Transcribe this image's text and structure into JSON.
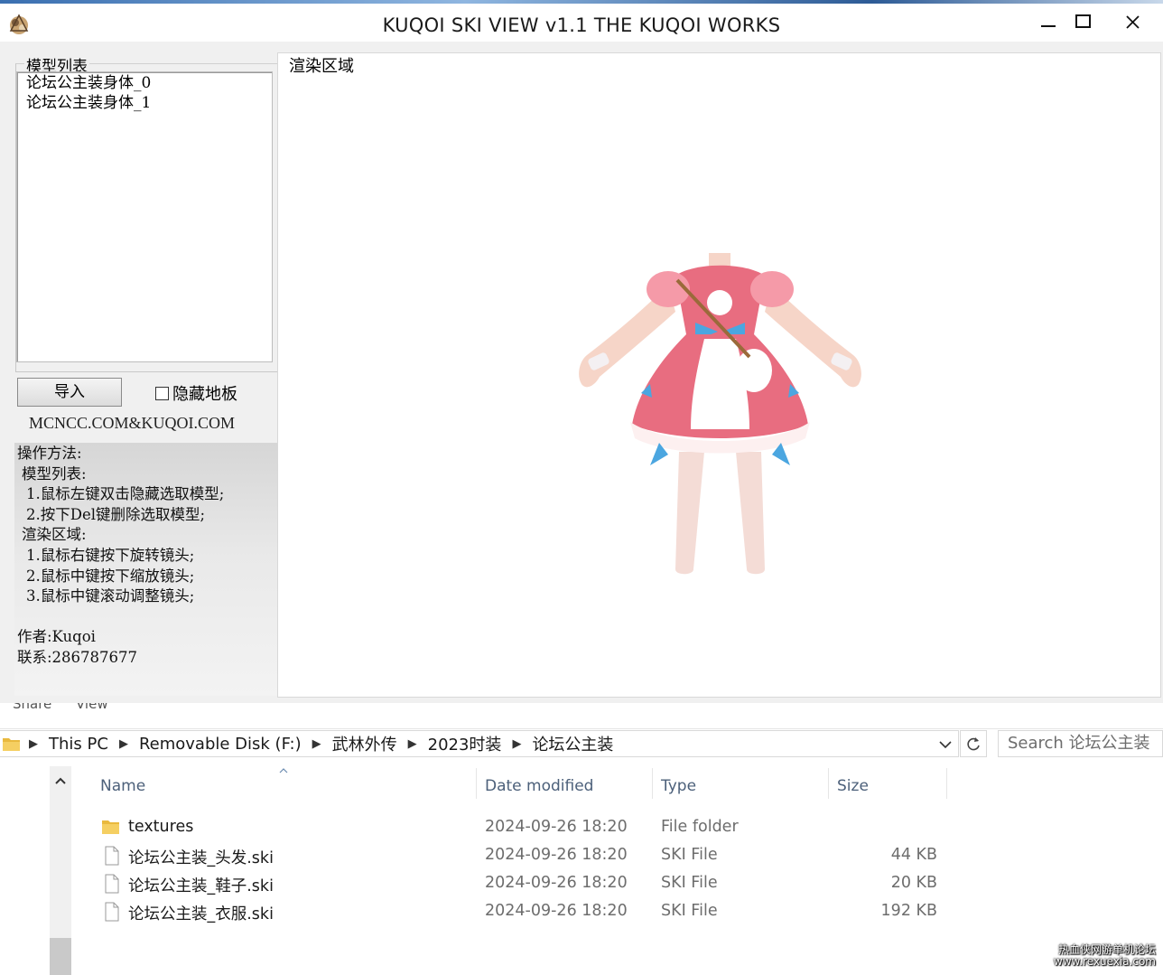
{
  "app": {
    "title": "KUQOI SKI VIEW v1.1 THE KUQOI WORKS",
    "model_list_label": "模型列表",
    "models": [
      "论坛公主装身体_0",
      "论坛公主装身体_1"
    ],
    "import_label": "导入",
    "hide_floor_label": "隐藏地板",
    "hide_floor_checked": false,
    "site_text": "MCNCC.COM&KUQOI.COM",
    "render_label": "渲染区域",
    "help_lines": [
      "操作方法:",
      " 模型列表:",
      "  1.鼠标左键双击隐藏选取模型;",
      "  2.按下Del键删除选取模型;",
      " 渲染区域:",
      "  1.鼠标右键按下旋转镜头;",
      "  2.鼠标中键按下缩放镜头;",
      "  3.鼠标中键滚动调整镜头;",
      "",
      "作者:Kuqoi",
      "联系:286787677"
    ]
  },
  "explorer": {
    "ribbon_tabs": [
      "Share",
      "View"
    ],
    "breadcrumb": [
      "This PC",
      "Removable Disk (F:)",
      "武林外传",
      "2023时装",
      "论坛公主装"
    ],
    "search_placeholder": "Search 论坛公主装",
    "columns": {
      "name": "Name",
      "date": "Date modified",
      "type": "Type",
      "size": "Size"
    },
    "files": [
      {
        "name": "textures",
        "date": "2024-09-26 18:20",
        "type": "File folder",
        "size": "",
        "icon": "folder-icon"
      },
      {
        "name": "论坛公主装_头发.ski",
        "date": "2024-09-26 18:20",
        "type": "SKI File",
        "size": "44 KB",
        "icon": "file-icon"
      },
      {
        "name": "论坛公主装_鞋子.ski",
        "date": "2024-09-26 18:20",
        "type": "SKI File",
        "size": "20 KB",
        "icon": "file-icon"
      },
      {
        "name": "论坛公主装_衣服.ski",
        "date": "2024-09-26 18:20",
        "type": "SKI File",
        "size": "192 KB",
        "icon": "file-icon"
      }
    ]
  },
  "watermark": {
    "line1": "热血侠网游单机论坛",
    "line2": "www.rexuexia.com"
  },
  "colors": {
    "dress_pink": "#e86d80",
    "bow_blue": "#4ba6e0",
    "skin": "#f6d5c8",
    "folder": "#f2c34e"
  }
}
